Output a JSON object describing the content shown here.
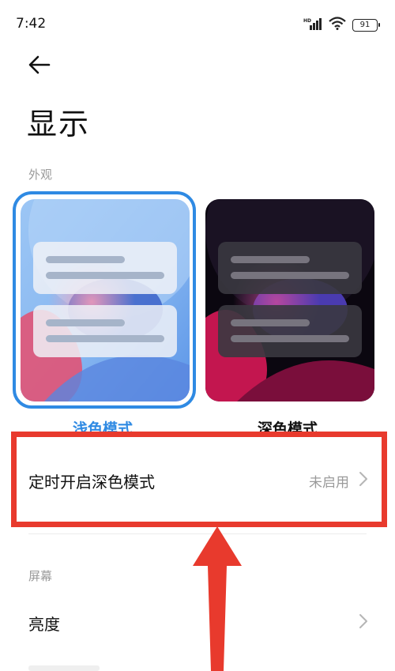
{
  "status_bar": {
    "time": "7:42",
    "network_badge": "HD",
    "battery_level": "91",
    "icons": [
      "signal-icon",
      "wifi-icon",
      "battery-icon"
    ]
  },
  "header": {
    "back_icon": "back-arrow-icon",
    "title": "显示"
  },
  "appearance": {
    "section_label": "外观",
    "themes": [
      {
        "label": "浅色模式",
        "selected": true
      },
      {
        "label": "深色模式",
        "selected": false
      }
    ]
  },
  "schedule_row": {
    "label": "定时开启深色模式",
    "value": "未启用",
    "icon": "chevron-right-icon"
  },
  "screen": {
    "section_label": "屏幕",
    "brightness_label": "亮度"
  },
  "annotation": {
    "highlight_color": "#e83a2d",
    "accent_color": "#2f8ae3"
  }
}
